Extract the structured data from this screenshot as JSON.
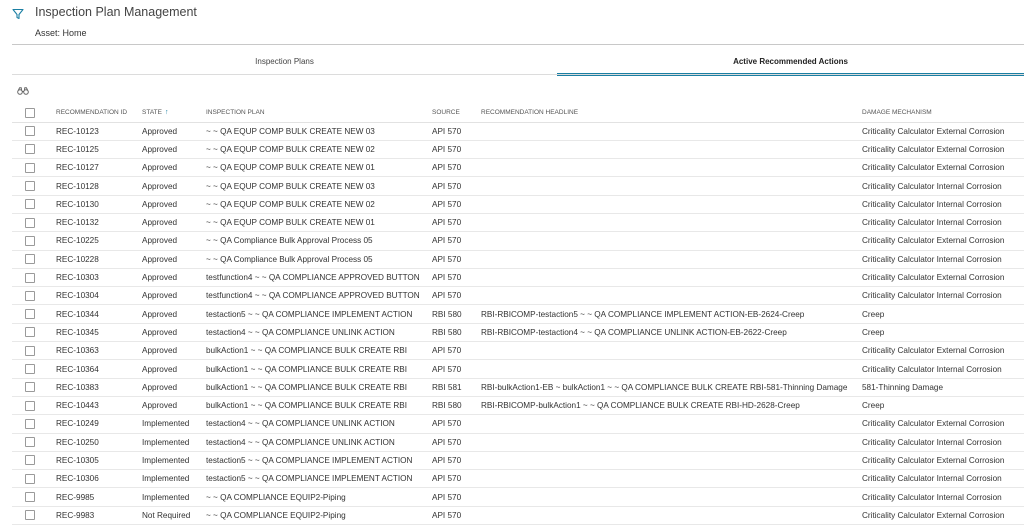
{
  "header": {
    "title": "Inspection Plan Management",
    "asset_label": "Asset:",
    "asset_value": "Home",
    "filter_icon": "filter-icon"
  },
  "tabs": [
    {
      "label": "Inspection Plans",
      "active": false
    },
    {
      "label": "Active Recommended Actions",
      "active": true
    }
  ],
  "toolbar": {
    "search_icon": "binoculars-icon"
  },
  "colors": {
    "accent": "#1b7fa3",
    "divider": "#c8c8c8"
  },
  "table": {
    "columns": {
      "id": "RECOMMENDATION ID",
      "state": "STATE",
      "state_sort": "ascending",
      "plan": "INSPECTION PLAN",
      "source": "SOURCE",
      "headline": "RECOMMENDATION HEADLINE",
      "mechanism": "DAMAGE MECHANISM"
    },
    "rows": [
      {
        "id": "REC-10123",
        "state": "Approved",
        "plan": "~ ~ QA EQUP COMP BULK CREATE NEW 03",
        "source": "API 570",
        "headline": "",
        "mechanism": "Criticality Calculator External Corrosion"
      },
      {
        "id": "REC-10125",
        "state": "Approved",
        "plan": "~ ~ QA EQUP COMP BULK CREATE NEW 02",
        "source": "API 570",
        "headline": "",
        "mechanism": "Criticality Calculator External Corrosion"
      },
      {
        "id": "REC-10127",
        "state": "Approved",
        "plan": "~ ~ QA EQUP COMP BULK CREATE NEW 01",
        "source": "API 570",
        "headline": "",
        "mechanism": "Criticality Calculator External Corrosion"
      },
      {
        "id": "REC-10128",
        "state": "Approved",
        "plan": "~ ~ QA EQUP COMP BULK CREATE NEW 03",
        "source": "API 570",
        "headline": "",
        "mechanism": "Criticality Calculator Internal Corrosion"
      },
      {
        "id": "REC-10130",
        "state": "Approved",
        "plan": "~ ~ QA EQUP COMP BULK CREATE NEW 02",
        "source": "API 570",
        "headline": "",
        "mechanism": "Criticality Calculator Internal Corrosion"
      },
      {
        "id": "REC-10132",
        "state": "Approved",
        "plan": "~ ~ QA EQUP COMP BULK CREATE NEW 01",
        "source": "API 570",
        "headline": "",
        "mechanism": "Criticality Calculator Internal Corrosion"
      },
      {
        "id": "REC-10225",
        "state": "Approved",
        "plan": "~ ~ QA Compliance Bulk Approval Process 05",
        "source": "API 570",
        "headline": "",
        "mechanism": "Criticality Calculator External Corrosion"
      },
      {
        "id": "REC-10228",
        "state": "Approved",
        "plan": "~ ~ QA Compliance Bulk Approval Process 05",
        "source": "API 570",
        "headline": "",
        "mechanism": "Criticality Calculator Internal Corrosion"
      },
      {
        "id": "REC-10303",
        "state": "Approved",
        "plan": "testfunction4 ~ ~ QA COMPLIANCE APPROVED BUTTON",
        "source": "API 570",
        "headline": "",
        "mechanism": "Criticality Calculator External Corrosion"
      },
      {
        "id": "REC-10304",
        "state": "Approved",
        "plan": "testfunction4 ~ ~ QA COMPLIANCE APPROVED BUTTON",
        "source": "API 570",
        "headline": "",
        "mechanism": "Criticality Calculator Internal Corrosion"
      },
      {
        "id": "REC-10344",
        "state": "Approved",
        "plan": "testaction5 ~ ~ QA COMPLIANCE IMPLEMENT ACTION",
        "source": "RBI 580",
        "headline": "RBI-RBICOMP-testaction5 ~ ~ QA COMPLIANCE IMPLEMENT ACTION-EB-2624-Creep",
        "mechanism": "Creep"
      },
      {
        "id": "REC-10345",
        "state": "Approved",
        "plan": "testaction4 ~ ~ QA COMPLIANCE UNLINK ACTION",
        "source": "RBI 580",
        "headline": "RBI-RBICOMP-testaction4 ~ ~ QA COMPLIANCE UNLINK ACTION-EB-2622-Creep",
        "mechanism": "Creep"
      },
      {
        "id": "REC-10363",
        "state": "Approved",
        "plan": "bulkAction1 ~ ~ QA COMPLIANCE BULK CREATE RBI",
        "source": "API 570",
        "headline": "",
        "mechanism": "Criticality Calculator External Corrosion"
      },
      {
        "id": "REC-10364",
        "state": "Approved",
        "plan": "bulkAction1 ~ ~ QA COMPLIANCE BULK CREATE RBI",
        "source": "API 570",
        "headline": "",
        "mechanism": "Criticality Calculator Internal Corrosion"
      },
      {
        "id": "REC-10383",
        "state": "Approved",
        "plan": "bulkAction1 ~ ~ QA COMPLIANCE BULK CREATE RBI",
        "source": "RBI 581",
        "headline": "RBI-bulkAction1-EB ~ bulkAction1 ~ ~ QA COMPLIANCE BULK CREATE RBI-581-Thinning Damage",
        "mechanism": "581-Thinning Damage"
      },
      {
        "id": "REC-10443",
        "state": "Approved",
        "plan": "bulkAction1 ~ ~ QA COMPLIANCE BULK CREATE RBI",
        "source": "RBI 580",
        "headline": "RBI-RBICOMP-bulkAction1 ~ ~ QA COMPLIANCE BULK CREATE RBI-HD-2628-Creep",
        "mechanism": "Creep"
      },
      {
        "id": "REC-10249",
        "state": "Implemented",
        "plan": "testaction4 ~ ~ QA COMPLIANCE UNLINK ACTION",
        "source": "API 570",
        "headline": "",
        "mechanism": "Criticality Calculator External Corrosion"
      },
      {
        "id": "REC-10250",
        "state": "Implemented",
        "plan": "testaction4 ~ ~ QA COMPLIANCE UNLINK ACTION",
        "source": "API 570",
        "headline": "",
        "mechanism": "Criticality Calculator Internal Corrosion"
      },
      {
        "id": "REC-10305",
        "state": "Implemented",
        "plan": "testaction5 ~ ~ QA COMPLIANCE IMPLEMENT ACTION",
        "source": "API 570",
        "headline": "",
        "mechanism": "Criticality Calculator External Corrosion"
      },
      {
        "id": "REC-10306",
        "state": "Implemented",
        "plan": "testaction5 ~ ~ QA COMPLIANCE IMPLEMENT ACTION",
        "source": "API 570",
        "headline": "",
        "mechanism": "Criticality Calculator Internal Corrosion"
      },
      {
        "id": "REC-9985",
        "state": "Implemented",
        "plan": "~ ~ QA COMPLIANCE EQUIP2-Piping",
        "source": "API 570",
        "headline": "",
        "mechanism": "Criticality Calculator Internal Corrosion"
      },
      {
        "id": "REC-9983",
        "state": "Not Required",
        "plan": "~ ~ QA COMPLIANCE EQUIP2-Piping",
        "source": "API 570",
        "headline": "",
        "mechanism": "Criticality Calculator External Corrosion"
      }
    ]
  }
}
